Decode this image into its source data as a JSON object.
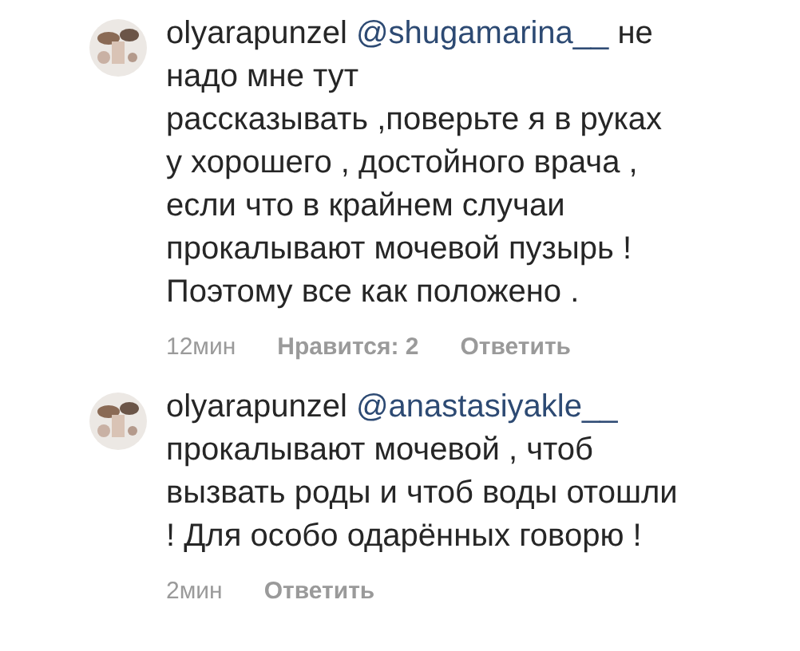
{
  "comments": [
    {
      "username": "olyarapunzel",
      "mention": "@shugamarina__",
      "text": "не\nнадо мне тут\nрассказывать ,поверьте я в руках\nу хорошего , достойного врача ,\nесли что в крайнем случаи\nпрокалывают  мочевой пузырь !\nПоэтому все как положено .",
      "time": "12мин",
      "likes": "Нравится: 2",
      "reply": "Ответить"
    },
    {
      "username": "olyarapunzel",
      "mention": "@anastasiyakle__",
      "text": "\nпрокалывают мочевой , чтоб\nвызвать роды и чтоб воды отошли\n! Для особо одарённых говорю !",
      "time": "2мин",
      "reply": "Ответить"
    }
  ]
}
